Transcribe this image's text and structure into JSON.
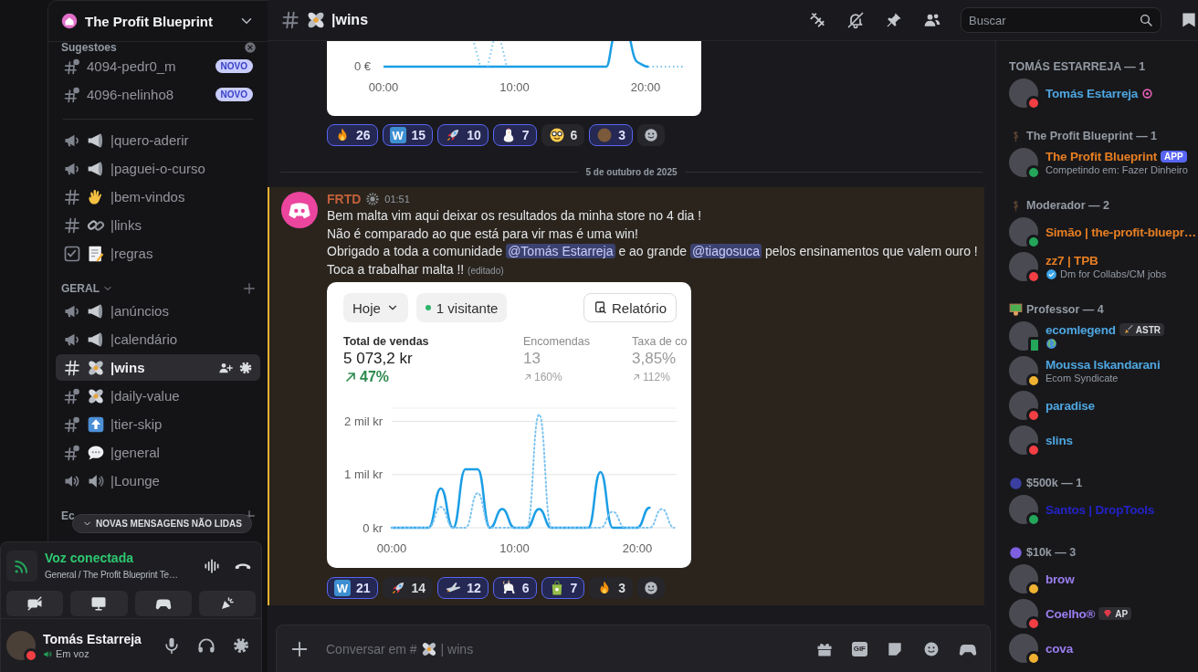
{
  "sidebar": {
    "server_name": "The Profit Blueprint",
    "sections": [
      {
        "title": "Sugestoes",
        "channels": [
          {
            "kind": "thread",
            "name": "4094-pedr0_m",
            "badge": "NOVO",
            "selected": false
          },
          {
            "kind": "thread",
            "name": "4096-nelinho8",
            "badge": "NOVO",
            "selected": false
          }
        ]
      },
      {
        "channels": [
          {
            "kind": "announcement",
            "name": "|quero-aderir",
            "selected": false
          },
          {
            "kind": "announcement",
            "name": "|paguei-o-curso",
            "selected": false
          },
          {
            "kind": "text",
            "name": "|bem-vindos",
            "selected": false
          },
          {
            "kind": "text",
            "name": "|links",
            "selected": false
          },
          {
            "kind": "rules",
            "name": "|regras",
            "selected": false
          }
        ]
      },
      {
        "title": "GERAL",
        "channels": [
          {
            "kind": "announcement",
            "name": "|anúncios",
            "selected": false
          },
          {
            "kind": "announcement",
            "name": "|calendário",
            "selected": false
          },
          {
            "kind": "text",
            "name": "|wins",
            "selected": true
          },
          {
            "kind": "thread",
            "name": "|daily-value",
            "selected": false
          },
          {
            "kind": "thread",
            "name": "|tier-skip",
            "selected": false
          },
          {
            "kind": "thread",
            "name": "|general",
            "selected": false
          },
          {
            "kind": "voice",
            "name": "|Lounge",
            "selected": false
          }
        ]
      },
      {
        "title": "Ec"
      }
    ],
    "unread_pill": "NOVAS MENSAGENS NÃO LIDAS",
    "voice": {
      "status": "Voz conectada",
      "channel": "General / The Profit Blueprint Te…"
    },
    "user": {
      "name": "Tomás Estarreja",
      "status": "Em voz"
    }
  },
  "header": {
    "channel": "|wins",
    "search": {
      "placeholder": "Buscar"
    }
  },
  "chat": {
    "top_embed": {
      "y_tick": "0 €",
      "x_ticks": [
        "00:00",
        "10:00",
        "20:00"
      ]
    },
    "top_reactions": [
      {
        "kind": "emoji",
        "count": "26",
        "selected": true
      },
      {
        "kind": "letter",
        "letter": "W",
        "count": "15",
        "selected": true
      },
      {
        "kind": "emoji",
        "count": "10",
        "selected": true
      },
      {
        "kind": "emoji",
        "count": "7",
        "selected": true
      },
      {
        "kind": "emoji",
        "count": "6",
        "selected": false
      },
      {
        "kind": "emoji",
        "count": "3",
        "selected": true
      }
    ],
    "date_divider": "5 de outubro de 2025",
    "message": {
      "author": "FRTD",
      "time": "01:51",
      "lines": [
        [
          {
            "kind": "text",
            "text": "Bem malta vim aqui deixar os resultados da minha store no 4 dia !"
          }
        ],
        [
          {
            "kind": "text",
            "text": "Não é comparado ao que está para vir mas é uma win!"
          }
        ],
        [
          {
            "kind": "text",
            "text": "Obrigado a toda a comunidade "
          },
          {
            "kind": "mention",
            "text": "@Tomás Estarreja"
          },
          {
            "kind": "text",
            "text": " e ao grande "
          },
          {
            "kind": "mention",
            "text": "@tiagosuca"
          },
          {
            "kind": "text",
            "text": " pelos ensinamentos que valem ouro !"
          }
        ],
        [
          {
            "kind": "text",
            "text": "Toca a trabalhar malta !! "
          }
        ]
      ],
      "edited": "(editado)",
      "embed": {
        "range": "Hoje",
        "visitors": "1 visitante",
        "report": "Relatório",
        "metrics": [
          {
            "label": "Total de vendas",
            "value": "5 073,2 kr",
            "change": "47%",
            "selected": true
          },
          {
            "label": "Encomendas",
            "value": "13",
            "change": "160%",
            "selected": false
          },
          {
            "label": "Taxa de co",
            "value": "3,85%",
            "change": "112%",
            "selected": false
          }
        ],
        "chart_data": {
          "type": "line",
          "x": [
            0,
            1,
            2,
            3,
            4,
            5,
            6,
            7,
            8,
            9,
            10,
            11,
            12,
            13,
            14,
            15,
            16,
            17,
            18,
            19,
            20,
            21,
            22,
            23
          ],
          "xlim": [
            0,
            23.2
          ],
          "ylim": [
            0,
            2.25
          ],
          "xticks": [
            {
              "value": 0,
              "label": "00:00"
            },
            {
              "value": 10,
              "label": "10:00"
            },
            {
              "value": 20,
              "label": "20:00"
            }
          ],
          "yticks": [
            {
              "value": 0,
              "label": "0 kr"
            },
            {
              "value": 1,
              "label": "1 mil kr"
            },
            {
              "value": 2,
              "label": "2 mil kr"
            }
          ],
          "series": [
            {
              "color": "#1b9ee5",
              "line_style": "solid",
              "values": [
                0,
                0,
                0,
                0,
                0.74,
                0,
                1.1,
                1.1,
                0,
                0.35,
                0,
                0,
                0.35,
                0,
                0,
                0,
                0,
                1.05,
                0,
                0,
                0,
                0.38,
                null,
                null
              ]
            },
            {
              "color": "#7cc3f0",
              "line_style": "dotted",
              "values": [
                0,
                0,
                0,
                0,
                0.39,
                0,
                0,
                0.65,
                0,
                0,
                0,
                0,
                2.13,
                0,
                0,
                0,
                0,
                0,
                0.3,
                0,
                0,
                0,
                0.35,
                0
              ]
            }
          ]
        }
      },
      "reactions": [
        {
          "kind": "letter",
          "letter": "W",
          "count": "21",
          "selected": true
        },
        {
          "kind": "emoji",
          "count": "14",
          "selected": false
        },
        {
          "kind": "emoji",
          "count": "12",
          "selected": true
        },
        {
          "kind": "emoji",
          "count": "6",
          "selected": true
        },
        {
          "kind": "emoji",
          "count": "7",
          "selected": true
        },
        {
          "kind": "emoji",
          "count": "3",
          "selected": false
        }
      ]
    },
    "composer": {
      "placeholder_start": "Conversar em #",
      "placeholder_end": "| wins",
      "gif": "GIF"
    }
  },
  "members": {
    "groups": [
      {
        "title": "TOMÁS ESTARREJA — 1",
        "members": [
          {
            "name": "Tomás Estarreja",
            "color": "#4ea6e0",
            "status_dot": {
              "color": "#f23f43",
              "mobile": false
            }
          }
        ]
      },
      {
        "title": "The Profit Blueprint — 1",
        "members": [
          {
            "name": "The Profit Blueprint",
            "color": "#e67e22",
            "status_dot": {
              "color": "#23a55a",
              "mobile": false
            },
            "tag": {
              "kind": "app",
              "text": "APP"
            },
            "subtitle": "Competindo em: Fazer Dinheiro"
          }
        ]
      },
      {
        "title": "Moderador — 2",
        "members": [
          {
            "name": "Simão | the-profit-bluepr…",
            "color": "#e67e22",
            "status_dot": {
              "color": "#23a55a",
              "mobile": false
            }
          },
          {
            "name": "zz7 | TPB",
            "color": "#e67e22",
            "status_dot": {
              "color": "#f23f43",
              "mobile": false
            },
            "subtitle": "Dm for Collabs/CM jobs"
          }
        ]
      },
      {
        "title": "Professor — 4",
        "members": [
          {
            "name": "ecomlegend",
            "color": "#4ea6e0",
            "status_dot": {
              "color": "#23a55a",
              "mobile": true
            },
            "tag": {
              "kind": "role",
              "text": "ASTR"
            }
          },
          {
            "name": "Moussa Iskandarani",
            "color": "#4ea6e0",
            "status_dot": {
              "color": "#f0b232",
              "mobile": false
            },
            "subtitle": "Ecom Syndicate"
          },
          {
            "name": "paradise",
            "color": "#4ea6e0",
            "status_dot": {
              "color": "#f23f43",
              "mobile": false
            }
          },
          {
            "name": "slins",
            "color": "#4ea6e0",
            "status_dot": {
              "color": "#f23f43",
              "mobile": false
            }
          }
        ]
      },
      {
        "title": "$500k — 1",
        "members": [
          {
            "name": "Santos | DropTools",
            "color": "#2323c8",
            "status_dot": {
              "color": "#23a55a",
              "mobile": false
            }
          }
        ]
      },
      {
        "title": "$10k — 3",
        "members": [
          {
            "name": "brow",
            "color": "#9b7ef0",
            "status_dot": {
              "color": "#f0b232",
              "mobile": false
            }
          },
          {
            "name": "Coelho®",
            "color": "#9b7ef0",
            "status_dot": {
              "color": "#f23f43",
              "mobile": false
            },
            "tag": {
              "kind": "role",
              "text": "AP"
            }
          },
          {
            "name": "cova",
            "color": "#9b7ef0",
            "status_dot": {
              "color": "#f0b232",
              "mobile": false
            }
          }
        ]
      }
    ]
  }
}
